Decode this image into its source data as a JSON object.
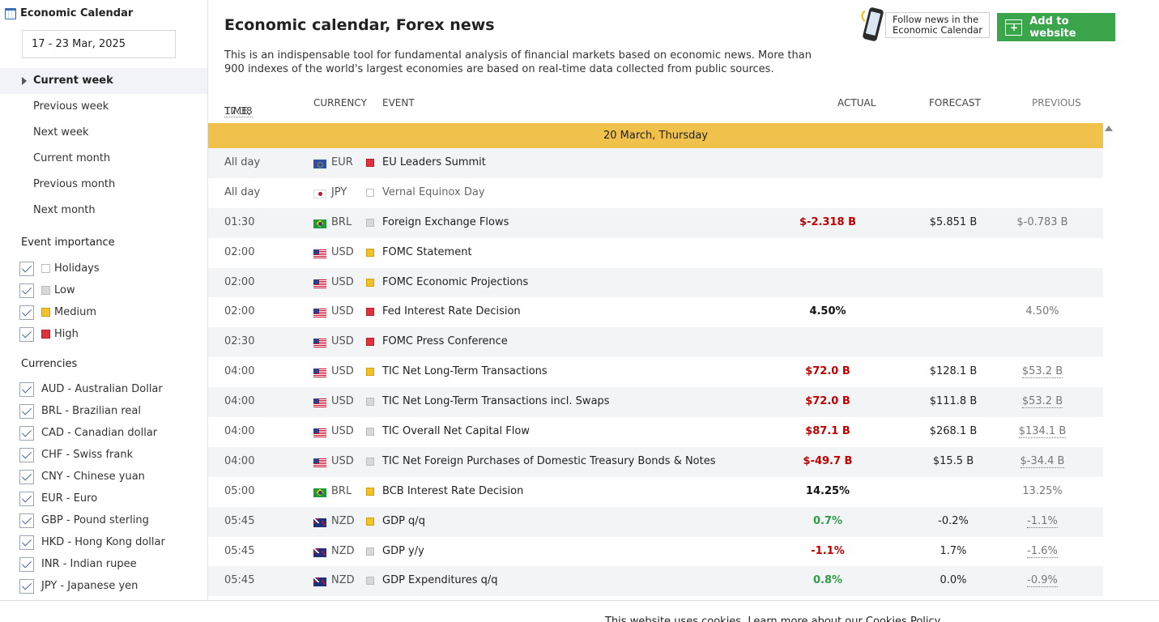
{
  "sidebar": {
    "title": "Economic Calendar",
    "date_range": "17  - 23 Mar, 2025",
    "periods": [
      {
        "label": "Current week",
        "active": true
      },
      {
        "label": "Previous week",
        "active": false
      },
      {
        "label": "Next week",
        "active": false
      },
      {
        "label": "Current month",
        "active": false
      },
      {
        "label": "Previous month",
        "active": false
      },
      {
        "label": "Next month",
        "active": false
      }
    ],
    "importance_title": "Event importance",
    "importance": [
      {
        "label": "Holidays",
        "level": "holiday",
        "checked": true
      },
      {
        "label": "Low",
        "level": "low",
        "checked": true
      },
      {
        "label": "Medium",
        "level": "medium",
        "checked": true
      },
      {
        "label": "High",
        "level": "high",
        "checked": true
      }
    ],
    "currencies_title": "Currencies",
    "currencies": [
      {
        "label": "AUD - Australian Dollar",
        "checked": true
      },
      {
        "label": "BRL - Brazilian real",
        "checked": true
      },
      {
        "label": "CAD - Canadian dollar",
        "checked": true
      },
      {
        "label": "CHF - Swiss frank",
        "checked": true
      },
      {
        "label": "CNY - Chinese yuan",
        "checked": true
      },
      {
        "label": "EUR - Euro",
        "checked": true
      },
      {
        "label": "GBP - Pound sterling",
        "checked": true
      },
      {
        "label": "HKD - Hong Kong dollar",
        "checked": true
      },
      {
        "label": "INR - Indian rupee",
        "checked": true
      },
      {
        "label": "JPY - Japanese yen",
        "checked": true
      }
    ]
  },
  "header": {
    "title": "Economic calendar, Forex news",
    "description": "This is an indispensable tool for fundamental analysis of financial markets based on economic news. More than 900 indexes of the world's largest economies are based on real-time data collected from public sources.",
    "follow_line1": "Follow news in the",
    "follow_line2": "Economic Calendar",
    "add_button": "Add to website"
  },
  "table": {
    "columns": {
      "time": "TIME,",
      "time_value": "17:38",
      "currency": "CURRENCY",
      "event": "EVENT",
      "actual": "ACTUAL",
      "forecast": "FORECAST",
      "previous": "PREVIOUS"
    },
    "date_band": "20 March, Thursday",
    "rows": [
      {
        "time": "All day",
        "flag": "eu",
        "currency": "EUR",
        "importance": "high",
        "event": "EU Leaders Summit",
        "actual": "",
        "actual_color": "",
        "forecast": "",
        "previous": "",
        "previous_revised": false,
        "muted": false
      },
      {
        "time": "All day",
        "flag": "jp",
        "currency": "JPY",
        "importance": "holiday",
        "event": "Vernal Equinox Day",
        "actual": "",
        "actual_color": "",
        "forecast": "",
        "previous": "",
        "previous_revised": false,
        "muted": true
      },
      {
        "time": "01:30",
        "flag": "br",
        "currency": "BRL",
        "importance": "low",
        "event": "Foreign Exchange Flows",
        "actual": "$-2.318 B",
        "actual_color": "red",
        "forecast": "$5.851 B",
        "previous": "$-0.783 B",
        "previous_revised": false,
        "muted": false
      },
      {
        "time": "02:00",
        "flag": "us",
        "currency": "USD",
        "importance": "medium",
        "event": "FOMC Statement",
        "actual": "",
        "actual_color": "",
        "forecast": "",
        "previous": "",
        "previous_revised": false,
        "muted": false
      },
      {
        "time": "02:00",
        "flag": "us",
        "currency": "USD",
        "importance": "medium",
        "event": "FOMC Economic Projections",
        "actual": "",
        "actual_color": "",
        "forecast": "",
        "previous": "",
        "previous_revised": false,
        "muted": false
      },
      {
        "time": "02:00",
        "flag": "us",
        "currency": "USD",
        "importance": "high",
        "event": "Fed Interest Rate Decision",
        "actual": "4.50%",
        "actual_color": "dark",
        "forecast": "",
        "previous": "4.50%",
        "previous_revised": false,
        "muted": false
      },
      {
        "time": "02:30",
        "flag": "us",
        "currency": "USD",
        "importance": "high",
        "event": "FOMC Press Conference",
        "actual": "",
        "actual_color": "",
        "forecast": "",
        "previous": "",
        "previous_revised": false,
        "muted": false
      },
      {
        "time": "04:00",
        "flag": "us",
        "currency": "USD",
        "importance": "medium",
        "event": "TIC Net Long-Term Transactions",
        "actual": "$72.0 B",
        "actual_color": "red",
        "forecast": "$128.1 B",
        "previous": "$53.2 B",
        "previous_revised": true,
        "muted": false
      },
      {
        "time": "04:00",
        "flag": "us",
        "currency": "USD",
        "importance": "low",
        "event": "TIC Net Long-Term Transactions incl. Swaps",
        "actual": "$72.0 B",
        "actual_color": "red",
        "forecast": "$111.8 B",
        "previous": "$53.2 B",
        "previous_revised": true,
        "muted": false
      },
      {
        "time": "04:00",
        "flag": "us",
        "currency": "USD",
        "importance": "low",
        "event": "TIC Overall Net Capital Flow",
        "actual": "$87.1 B",
        "actual_color": "red",
        "forecast": "$268.1 B",
        "previous": "$134.1 B",
        "previous_revised": true,
        "muted": false
      },
      {
        "time": "04:00",
        "flag": "us",
        "currency": "USD",
        "importance": "low",
        "event": "TIC Net Foreign Purchases of Domestic Treasury Bonds & Notes",
        "actual": "$-49.7 B",
        "actual_color": "red",
        "forecast": "$15.5 B",
        "previous": "$-34.4 B",
        "previous_revised": true,
        "muted": false
      },
      {
        "time": "05:00",
        "flag": "br",
        "currency": "BRL",
        "importance": "medium",
        "event": "BCB Interest Rate Decision",
        "actual": "14.25%",
        "actual_color": "dark",
        "forecast": "",
        "previous": "13.25%",
        "previous_revised": false,
        "muted": false
      },
      {
        "time": "05:45",
        "flag": "nz",
        "currency": "NZD",
        "importance": "medium",
        "event": "GDP q/q",
        "actual": "0.7%",
        "actual_color": "green",
        "forecast": "-0.2%",
        "previous": "-1.1%",
        "previous_revised": true,
        "muted": false
      },
      {
        "time": "05:45",
        "flag": "nz",
        "currency": "NZD",
        "importance": "low",
        "event": "GDP y/y",
        "actual": "-1.1%",
        "actual_color": "red",
        "forecast": "1.7%",
        "previous": "-1.6%",
        "previous_revised": true,
        "muted": false
      },
      {
        "time": "05:45",
        "flag": "nz",
        "currency": "NZD",
        "importance": "low",
        "event": "GDP Expenditures q/q",
        "actual": "0.8%",
        "actual_color": "green",
        "forecast": "0.0%",
        "previous": "-0.9%",
        "previous_revised": true,
        "muted": false
      }
    ]
  },
  "cookie": {
    "text": "This website uses cookies. Learn more about our Cookies Policy."
  }
}
